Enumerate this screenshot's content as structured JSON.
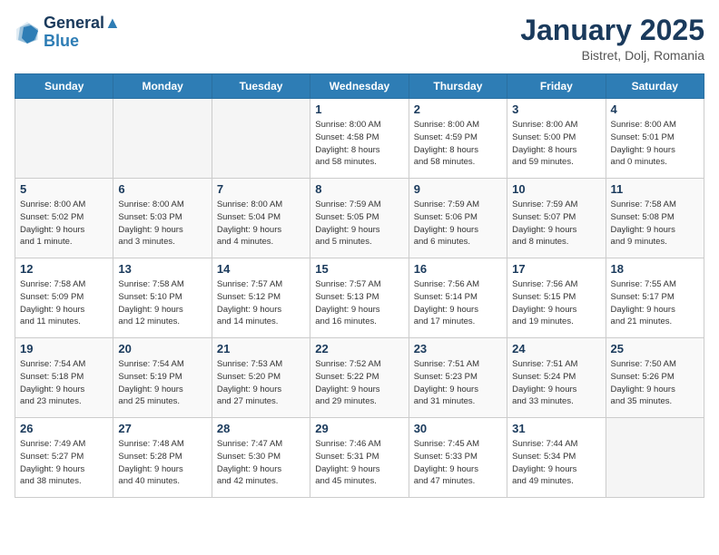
{
  "header": {
    "logo_line1": "General",
    "logo_line2": "Blue",
    "month": "January 2025",
    "location": "Bistret, Dolj, Romania"
  },
  "weekdays": [
    "Sunday",
    "Monday",
    "Tuesday",
    "Wednesday",
    "Thursday",
    "Friday",
    "Saturday"
  ],
  "weeks": [
    [
      {
        "day": "",
        "info": ""
      },
      {
        "day": "",
        "info": ""
      },
      {
        "day": "",
        "info": ""
      },
      {
        "day": "1",
        "info": "Sunrise: 8:00 AM\nSunset: 4:58 PM\nDaylight: 8 hours\nand 58 minutes."
      },
      {
        "day": "2",
        "info": "Sunrise: 8:00 AM\nSunset: 4:59 PM\nDaylight: 8 hours\nand 58 minutes."
      },
      {
        "day": "3",
        "info": "Sunrise: 8:00 AM\nSunset: 5:00 PM\nDaylight: 8 hours\nand 59 minutes."
      },
      {
        "day": "4",
        "info": "Sunrise: 8:00 AM\nSunset: 5:01 PM\nDaylight: 9 hours\nand 0 minutes."
      }
    ],
    [
      {
        "day": "5",
        "info": "Sunrise: 8:00 AM\nSunset: 5:02 PM\nDaylight: 9 hours\nand 1 minute."
      },
      {
        "day": "6",
        "info": "Sunrise: 8:00 AM\nSunset: 5:03 PM\nDaylight: 9 hours\nand 3 minutes."
      },
      {
        "day": "7",
        "info": "Sunrise: 8:00 AM\nSunset: 5:04 PM\nDaylight: 9 hours\nand 4 minutes."
      },
      {
        "day": "8",
        "info": "Sunrise: 7:59 AM\nSunset: 5:05 PM\nDaylight: 9 hours\nand 5 minutes."
      },
      {
        "day": "9",
        "info": "Sunrise: 7:59 AM\nSunset: 5:06 PM\nDaylight: 9 hours\nand 6 minutes."
      },
      {
        "day": "10",
        "info": "Sunrise: 7:59 AM\nSunset: 5:07 PM\nDaylight: 9 hours\nand 8 minutes."
      },
      {
        "day": "11",
        "info": "Sunrise: 7:58 AM\nSunset: 5:08 PM\nDaylight: 9 hours\nand 9 minutes."
      }
    ],
    [
      {
        "day": "12",
        "info": "Sunrise: 7:58 AM\nSunset: 5:09 PM\nDaylight: 9 hours\nand 11 minutes."
      },
      {
        "day": "13",
        "info": "Sunrise: 7:58 AM\nSunset: 5:10 PM\nDaylight: 9 hours\nand 12 minutes."
      },
      {
        "day": "14",
        "info": "Sunrise: 7:57 AM\nSunset: 5:12 PM\nDaylight: 9 hours\nand 14 minutes."
      },
      {
        "day": "15",
        "info": "Sunrise: 7:57 AM\nSunset: 5:13 PM\nDaylight: 9 hours\nand 16 minutes."
      },
      {
        "day": "16",
        "info": "Sunrise: 7:56 AM\nSunset: 5:14 PM\nDaylight: 9 hours\nand 17 minutes."
      },
      {
        "day": "17",
        "info": "Sunrise: 7:56 AM\nSunset: 5:15 PM\nDaylight: 9 hours\nand 19 minutes."
      },
      {
        "day": "18",
        "info": "Sunrise: 7:55 AM\nSunset: 5:17 PM\nDaylight: 9 hours\nand 21 minutes."
      }
    ],
    [
      {
        "day": "19",
        "info": "Sunrise: 7:54 AM\nSunset: 5:18 PM\nDaylight: 9 hours\nand 23 minutes."
      },
      {
        "day": "20",
        "info": "Sunrise: 7:54 AM\nSunset: 5:19 PM\nDaylight: 9 hours\nand 25 minutes."
      },
      {
        "day": "21",
        "info": "Sunrise: 7:53 AM\nSunset: 5:20 PM\nDaylight: 9 hours\nand 27 minutes."
      },
      {
        "day": "22",
        "info": "Sunrise: 7:52 AM\nSunset: 5:22 PM\nDaylight: 9 hours\nand 29 minutes."
      },
      {
        "day": "23",
        "info": "Sunrise: 7:51 AM\nSunset: 5:23 PM\nDaylight: 9 hours\nand 31 minutes."
      },
      {
        "day": "24",
        "info": "Sunrise: 7:51 AM\nSunset: 5:24 PM\nDaylight: 9 hours\nand 33 minutes."
      },
      {
        "day": "25",
        "info": "Sunrise: 7:50 AM\nSunset: 5:26 PM\nDaylight: 9 hours\nand 35 minutes."
      }
    ],
    [
      {
        "day": "26",
        "info": "Sunrise: 7:49 AM\nSunset: 5:27 PM\nDaylight: 9 hours\nand 38 minutes."
      },
      {
        "day": "27",
        "info": "Sunrise: 7:48 AM\nSunset: 5:28 PM\nDaylight: 9 hours\nand 40 minutes."
      },
      {
        "day": "28",
        "info": "Sunrise: 7:47 AM\nSunset: 5:30 PM\nDaylight: 9 hours\nand 42 minutes."
      },
      {
        "day": "29",
        "info": "Sunrise: 7:46 AM\nSunset: 5:31 PM\nDaylight: 9 hours\nand 45 minutes."
      },
      {
        "day": "30",
        "info": "Sunrise: 7:45 AM\nSunset: 5:33 PM\nDaylight: 9 hours\nand 47 minutes."
      },
      {
        "day": "31",
        "info": "Sunrise: 7:44 AM\nSunset: 5:34 PM\nDaylight: 9 hours\nand 49 minutes."
      },
      {
        "day": "",
        "info": ""
      }
    ]
  ]
}
